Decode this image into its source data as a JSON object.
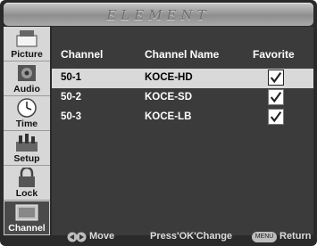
{
  "header": {
    "brand": "ELEMENT"
  },
  "sidebar": {
    "items": [
      {
        "label": "Picture",
        "icon": "picture-icon",
        "active": false
      },
      {
        "label": "Audio",
        "icon": "audio-icon",
        "active": false
      },
      {
        "label": "Time",
        "icon": "time-icon",
        "active": false
      },
      {
        "label": "Setup",
        "icon": "setup-icon",
        "active": false
      },
      {
        "label": "Lock",
        "icon": "lock-icon",
        "active": false
      },
      {
        "label": "Channel",
        "icon": "channel-icon",
        "active": true
      }
    ]
  },
  "table": {
    "headers": {
      "channel": "Channel",
      "name": "Channel Name",
      "favorite": "Favorite"
    },
    "rows": [
      {
        "channel": "50-1",
        "name": "KOCE-HD",
        "favorite": true,
        "selected": true
      },
      {
        "channel": "50-2",
        "name": "KOCE-SD",
        "favorite": true,
        "selected": false
      },
      {
        "channel": "50-3",
        "name": "KOCE-LB",
        "favorite": true,
        "selected": false
      }
    ]
  },
  "footer": {
    "move": "Move",
    "change": "Press'OK'Change",
    "menu_button": "MENU",
    "return": "Return"
  },
  "colors": {
    "highlight": "#d9d9d9",
    "panel": "#3b3b3b",
    "sidebar": "#d7d7d7"
  }
}
